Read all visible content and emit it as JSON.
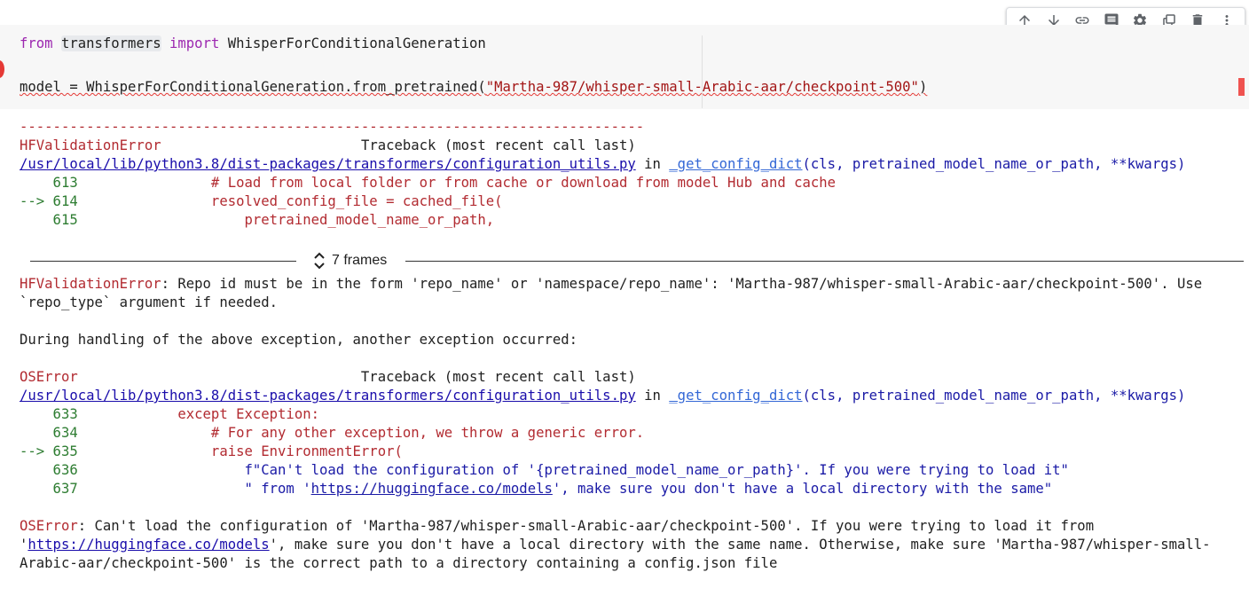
{
  "toolbar": {
    "buttons": [
      {
        "icon": "arrow-up-icon"
      },
      {
        "icon": "arrow-down-icon"
      },
      {
        "icon": "link-icon"
      },
      {
        "icon": "comment-icon"
      },
      {
        "icon": "gear-icon"
      },
      {
        "icon": "mirror-cell-icon"
      },
      {
        "icon": "trash-icon"
      },
      {
        "icon": "more-vert-icon"
      }
    ]
  },
  "cell": {
    "line1": {
      "kw_from": "from",
      "module": "transformers",
      "kw_import": "import",
      "name": "WhisperForConditionalGeneration"
    },
    "line2": {
      "prefix": "model = WhisperForConditionalGeneration.from_pretrained(",
      "arg": "\"Martha-987/whisper-small-Arabic-aar/checkpoint-500\"",
      "suffix": ")"
    }
  },
  "output": {
    "dashes": "---------------------------------------------------------------------------",
    "err1": {
      "name": "HFValidationError",
      "traceback": "Traceback (most recent call last)",
      "path": "/usr/local/lib/python3.8/dist-packages/transformers/configuration_utils.py",
      "in": "in",
      "func": "_get_config_dict",
      "args": "(cls, pretrained_model_name_or_path, **kwargs)",
      "lines": [
        {
          "num": "    613",
          "code": "                # Load from local folder or from cache or download from model Hub and cache"
        },
        {
          "num": "--> 614",
          "code": "                resolved_config_file = cached_file("
        },
        {
          "num": "    615",
          "code": "                    pretrained_model_name_or_path,"
        }
      ]
    },
    "frames_label": "7 frames",
    "err1_msg_name": "HFValidationError",
    "err1_msg": ": Repo id must be in the form 'repo_name' or 'namespace/repo_name': 'Martha-987/whisper-small-Arabic-aar/checkpoint-500'. Use",
    "err1_msg_2": "`repo_type` argument if needed.",
    "during": "During handling of the above exception, another exception occurred:",
    "err2": {
      "name": "OSError",
      "traceback": "Traceback (most recent call last)",
      "path": "/usr/local/lib/python3.8/dist-packages/transformers/configuration_utils.py",
      "in": "in",
      "func": "_get_config_dict",
      "args": "(cls, pretrained_model_name_or_path, **kwargs)",
      "lines": [
        {
          "num": "    633",
          "code": "            except Exception:"
        },
        {
          "num": "    634",
          "code": "                # For any other exception, we throw a generic error."
        },
        {
          "num": "--> 635",
          "code": "                raise EnvironmentError("
        },
        {
          "num": "    636",
          "code": "                    f\"Can't load the configuration of '{pretrained_model_name_or_path}'. If you were trying to load it\""
        },
        {
          "num": "    637",
          "code_pre": "                    \" from '",
          "code_link": "https://huggingface.co/models",
          "code_post": "', make sure you don't have a local directory with the same\""
        }
      ]
    },
    "final": {
      "name": "OSError",
      "line1": ": Can't load the configuration of 'Martha-987/whisper-small-Arabic-aar/checkpoint-500'. If you were trying to load it from",
      "line2_pre": "'",
      "line2_link": "https://huggingface.co/models",
      "line2_post": "', make sure you don't have a local directory with the same name. Otherwise, make sure 'Martha-987/whisper-small-",
      "line3": "Arabic-aar/checkpoint-500' is the correct path to a directory containing a config.json file"
    }
  }
}
